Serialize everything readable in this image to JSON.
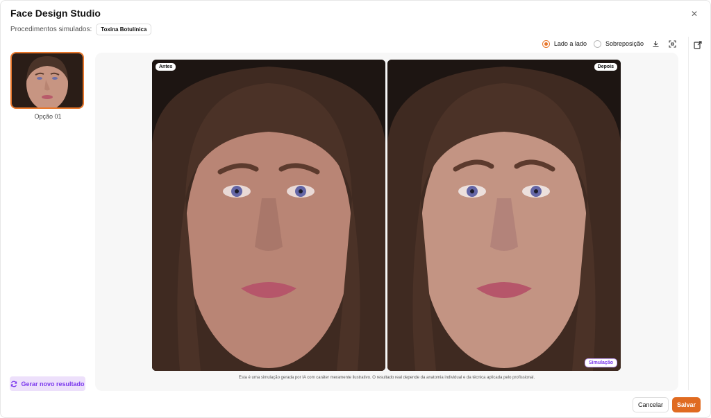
{
  "app": {
    "title": "Face Design Studio",
    "procedures_label": "Procedimentos simulados:",
    "procedure_badge": "Toxina Botulínica"
  },
  "sidebar": {
    "options": [
      {
        "label": "Opção 01",
        "selected": true
      }
    ],
    "regenerate_label": "Gerar novo resultado"
  },
  "toolbar": {
    "view_modes": [
      {
        "label": "Lado a lado",
        "selected": true
      },
      {
        "label": "Sobreposição",
        "selected": false
      }
    ],
    "icons": [
      "download-icon",
      "fullscreen-icon"
    ]
  },
  "comparison": {
    "before_tag": "Antes",
    "after_tag": "Depois",
    "simulation_tag": "Simulação",
    "disclaimer": "Esta é uma simulação gerada por IA com caráter meramente ilustrativo. O resultado real depende da anatomia individual e da técnica aplicada pelo profissional."
  },
  "footer": {
    "cancel_label": "Cancelar",
    "save_label": "Salvar"
  },
  "colors": {
    "accent": "#e06b21",
    "purple": "#7c3aed"
  }
}
